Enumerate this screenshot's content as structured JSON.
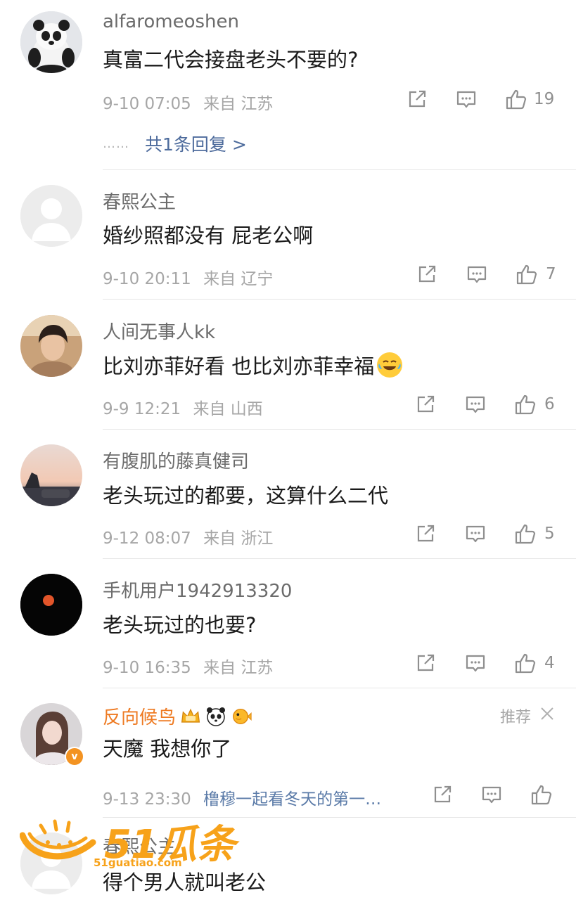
{
  "comments": [
    {
      "username": "alfaromeoshen",
      "content": "真富二代会接盘老头不要的?",
      "date": "9-10 07:05",
      "location": "来自 江苏",
      "likes": "19",
      "reply_link": "共1条回复 >",
      "reply_dots": "……"
    },
    {
      "username": "春熙公主",
      "content": "婚纱照都没有 屁老公啊",
      "date": "9-10 20:11",
      "location": "来自 辽宁",
      "likes": "7"
    },
    {
      "username": "人间无事人kk",
      "content": "比刘亦菲好看 也比刘亦菲幸福",
      "date": "9-9 12:21",
      "location": "来自 山西",
      "likes": "6"
    },
    {
      "username": "有腹肌的藤真健司",
      "content": "老头玩过的都要，这算什么二代",
      "date": "9-12 08:07",
      "location": "来自 浙江",
      "likes": "5"
    },
    {
      "username": "手机用户1942913320",
      "content": "老头玩过的也要?",
      "date": "9-10 16:35",
      "location": "来自 江苏",
      "likes": "4"
    },
    {
      "username": "反向候鸟",
      "content": "天魔 我想你了",
      "date": "9-13 23:30",
      "topic": "橹穆一起看冬天的第一…",
      "recommend": "推荐",
      "verify": "v"
    },
    {
      "username": "春熙公主",
      "content": "得个男人就叫老公"
    }
  ],
  "watermark": {
    "brand": "51瓜条",
    "url": "51guatiao.com"
  },
  "colors": {
    "accent_link": "#4d6b9c",
    "vip_name": "#ee7a22",
    "watermark": "#f7a21a"
  }
}
